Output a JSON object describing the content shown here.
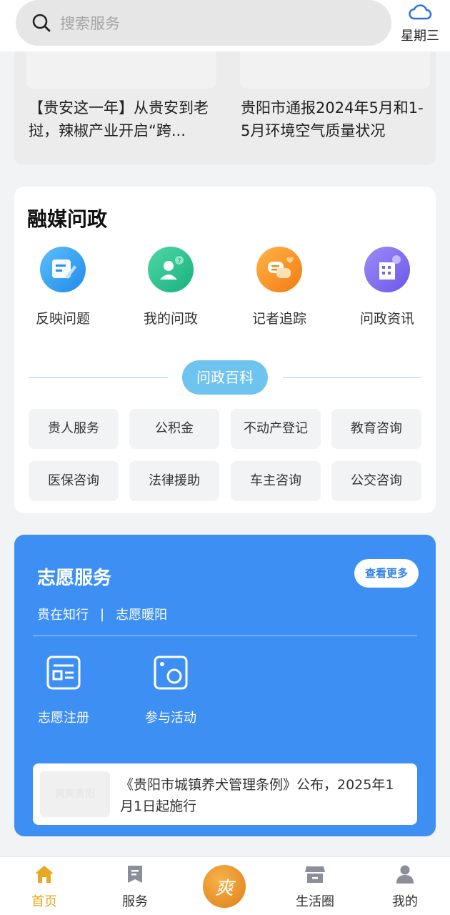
{
  "search": {
    "placeholder": "搜索服务",
    "icon": "search-icon"
  },
  "weather": {
    "icon": "cloud-icon",
    "weekday": "星期三"
  },
  "news_cards": [
    {
      "title": "【贵安这一年】从贵安到老挝，辣椒产业开启“跨..."
    },
    {
      "title": "贵阳市通报2024年5月和1-5月环境空气质量状况"
    }
  ],
  "rongmei": {
    "title": "融媒问政",
    "icons": [
      {
        "label": "反映问题",
        "icon": "report-icon",
        "color": "#2f9bf0"
      },
      {
        "label": "我的问政",
        "icon": "user-question-icon",
        "color": "#22c08e"
      },
      {
        "label": "记者追踪",
        "icon": "chat-icon",
        "color": "#f7941d"
      },
      {
        "label": "问政资讯",
        "icon": "building-icon",
        "color": "#7b6cf0"
      }
    ],
    "encyclopedia_label": "问政百科",
    "tags": [
      "贵人服务",
      "公积金",
      "不动产登记",
      "教育咨询",
      "医保咨询",
      "法律援助",
      "车主咨询",
      "公交咨询"
    ]
  },
  "volunteer": {
    "title": "志愿服务",
    "more_label": "查看更多",
    "sub_left": "贵在知行",
    "sub_sep": "|",
    "sub_right": "志愿暖阳",
    "items": [
      {
        "label": "志愿注册",
        "icon": "register-icon"
      },
      {
        "label": "参与活动",
        "icon": "camera-icon"
      }
    ],
    "news": {
      "thumb_text": "爽爽贵阳",
      "text": "《贵阳市城镇养犬管理条例》公布，2025年1月1日起施行"
    }
  },
  "tabbar": {
    "items": [
      {
        "label": "首页",
        "icon": "home-icon",
        "active": true
      },
      {
        "label": "服务",
        "icon": "bookmark-icon",
        "active": false
      },
      {
        "label": "",
        "icon": "logo-icon",
        "active": false
      },
      {
        "label": "生活圈",
        "icon": "store-icon",
        "active": false
      },
      {
        "label": "我的",
        "icon": "person-icon",
        "active": false
      }
    ],
    "center_glyph": "爽"
  },
  "colors": {
    "accent": "#e9a81e",
    "volunteer_bg": "#3d8ff4",
    "pill": "#6fc3ef"
  }
}
